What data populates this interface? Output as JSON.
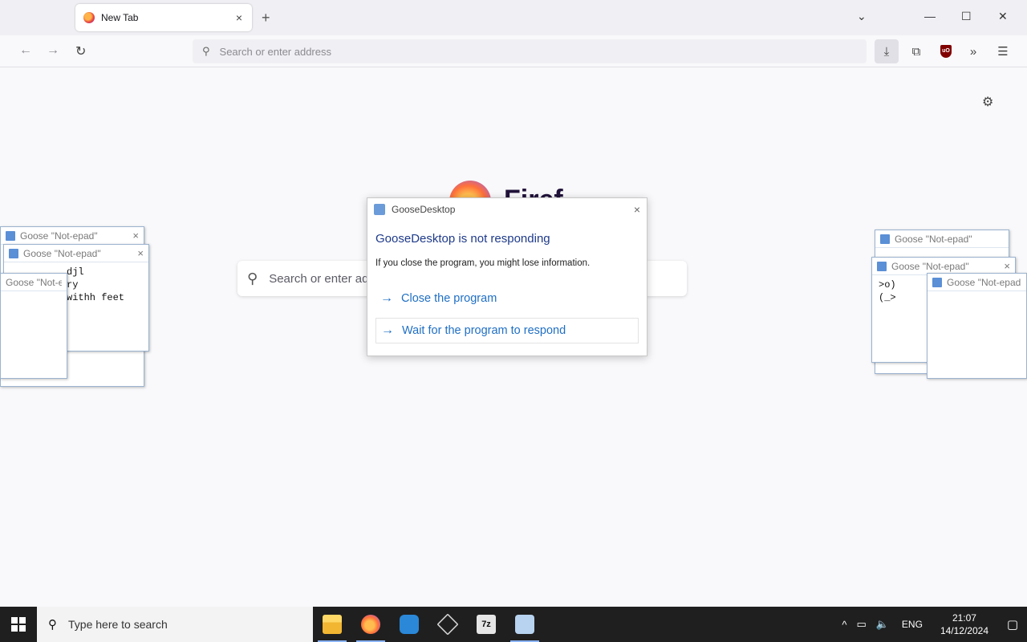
{
  "browser": {
    "tab_title": "New Tab",
    "tab_close": "×",
    "new_tab": "+",
    "window_controls": {
      "list": "⌄",
      "minimize": "—",
      "maximize": "☐",
      "close": "✕"
    },
    "nav": {
      "back": "←",
      "forward": "→",
      "reload": "↻"
    },
    "url_placeholder": "Search or enter address",
    "toolbar": {
      "downloads": "⤓",
      "extensions": "⧉",
      "ublock": "uO",
      "overflow": "»",
      "menu": "☰"
    },
    "content": {
      "wordmark": "Firef",
      "search_placeholder": "Search or enter address",
      "settings_icon": "⚙"
    }
  },
  "notepads": {
    "left": [
      {
        "title": "Goose \"Not-epad\"",
        "text": ""
      },
      {
        "title": "Goose \"Not-epad\"",
        "text": "djl\nry\nwithh feet"
      },
      {
        "title": "Goose \"Not-epad\"",
        "text": ""
      }
    ],
    "right": [
      {
        "title": "Goose \"Not-epad\"",
        "text": ""
      },
      {
        "title": "Goose \"Not-epad\"",
        "text": ">o)\n(_>"
      },
      {
        "title": "Goose \"Not-epad\"",
        "text": ""
      }
    ],
    "close": "×"
  },
  "dialog": {
    "title": "GooseDesktop",
    "heading": "GooseDesktop is not responding",
    "message": "If you close the program, you might lose information.",
    "option_close": "Close the program",
    "option_wait": "Wait for the program to respond",
    "arrow": "→",
    "close": "×"
  },
  "taskbar": {
    "search_placeholder": "Type here to search",
    "zip_label": "7z",
    "tray": {
      "chevron": "^",
      "network": "▭",
      "volume": "🔈",
      "language": "ENG"
    },
    "clock": {
      "time": "21:07",
      "date": "14/12/2024"
    },
    "notifications": "▢"
  }
}
